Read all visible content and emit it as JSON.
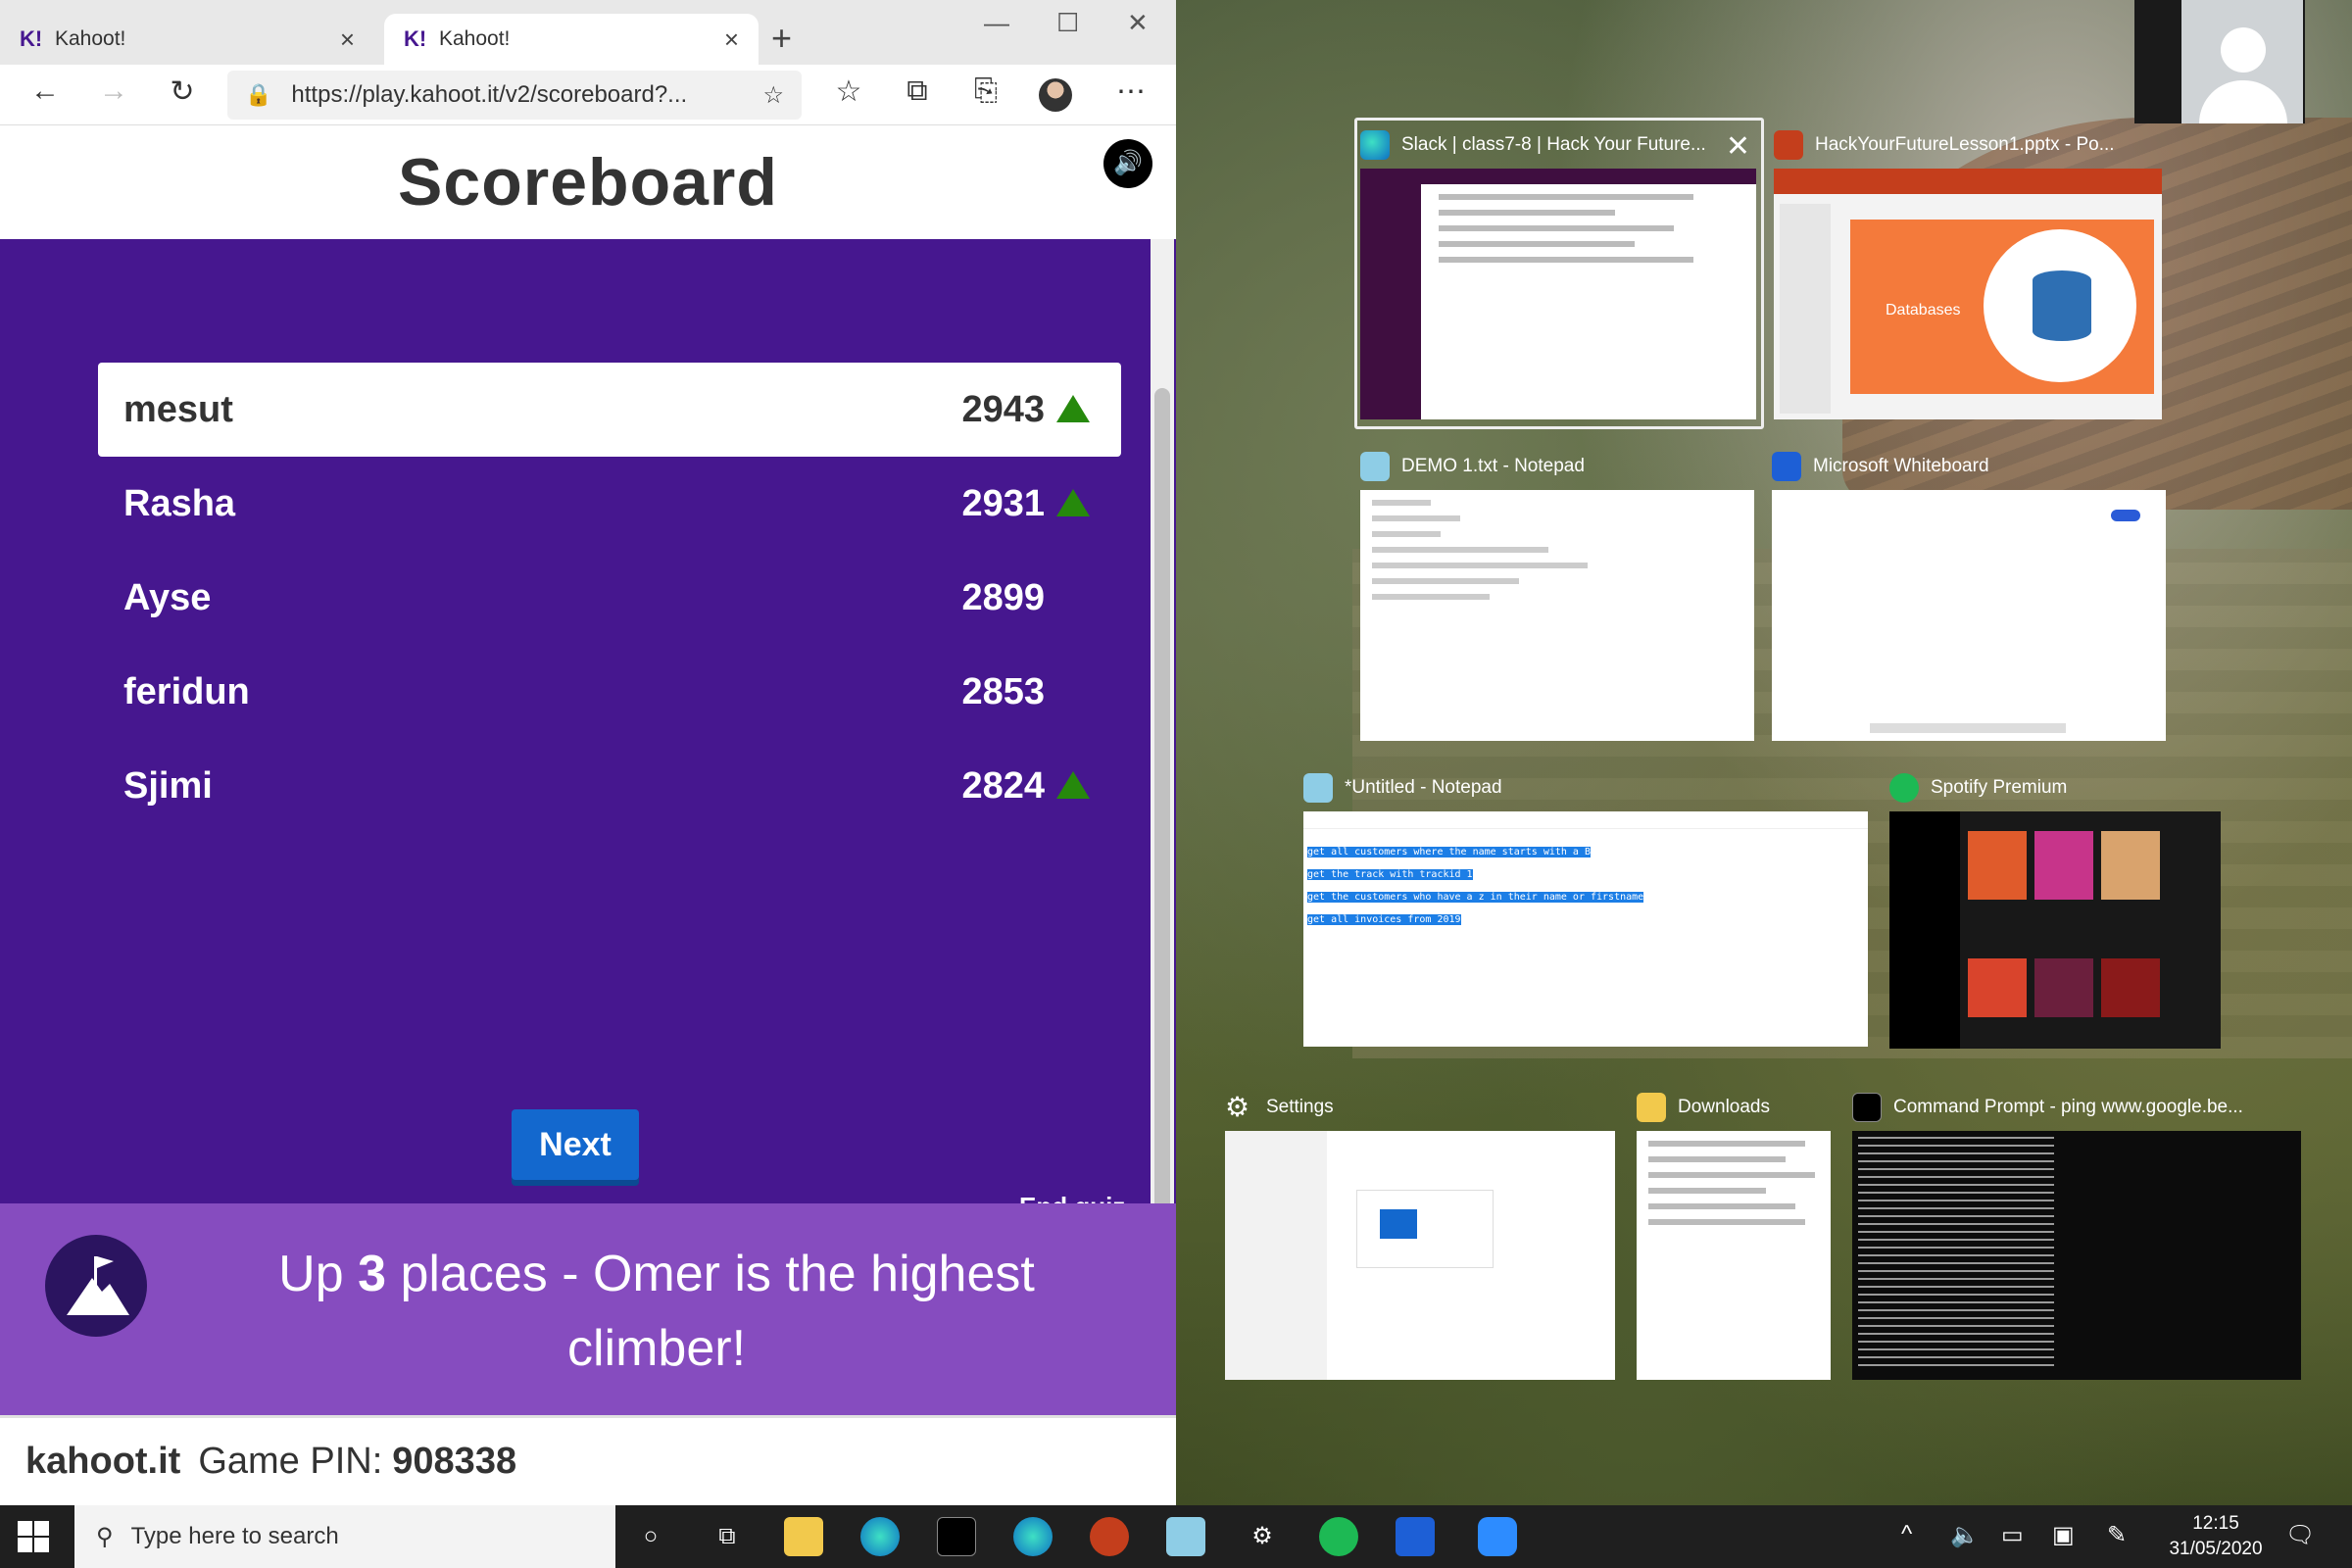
{
  "browser": {
    "tabs": [
      {
        "logo": "K!",
        "title": "Kahoot!"
      },
      {
        "logo": "K!",
        "title": "Kahoot!"
      }
    ],
    "url": "https://play.kahoot.it/v2/scoreboard?..."
  },
  "kahoot": {
    "title": "Scoreboard",
    "players": [
      {
        "name": "mesut",
        "score": "2943",
        "up": true
      },
      {
        "name": "Rasha",
        "score": "2931",
        "up": true
      },
      {
        "name": "Ayse",
        "score": "2899",
        "up": false
      },
      {
        "name": "feridun",
        "score": "2853",
        "up": false
      },
      {
        "name": "Sjimi",
        "score": "2824",
        "up": true
      }
    ],
    "next_label": "Next",
    "end_quiz_label": "End quiz",
    "climber": {
      "prefix": "Up",
      "count": "3",
      "suffix": "places - Omer is the highest climber!"
    },
    "footer": {
      "site": "kahoot.it",
      "pin_label": "Game PIN:",
      "pin": "908338"
    }
  },
  "task_view": {
    "windows": [
      {
        "title": "Slack | class7-8 | Hack Your Future...",
        "icon": "edge-icon"
      },
      {
        "title": "HackYourFutureLesson1.pptx - Po...",
        "icon": "powerpoint-icon",
        "slide_text": "Databases"
      },
      {
        "title": "DEMO 1.txt - Notepad",
        "icon": "notepad-icon"
      },
      {
        "title": "Microsoft Whiteboard",
        "icon": "whiteboard-icon"
      },
      {
        "title": "*Untitled - Notepad",
        "icon": "notepad-icon",
        "lines": [
          "get all customers where the name starts with a B",
          "get the track with trackid 1",
          "get the customers who have a z in their name or firstname",
          "get all invoices from 2019"
        ]
      },
      {
        "title": "Spotify Premium",
        "icon": "spotify-icon"
      },
      {
        "title": "Settings",
        "icon": "gear-icon"
      },
      {
        "title": "Downloads",
        "icon": "folder-icon"
      },
      {
        "title": "Command Prompt - ping  www.google.be...",
        "icon": "cmd-icon"
      }
    ]
  },
  "taskbar": {
    "search_placeholder": "Type here to search",
    "time": "12:15",
    "date": "31/05/2020"
  }
}
